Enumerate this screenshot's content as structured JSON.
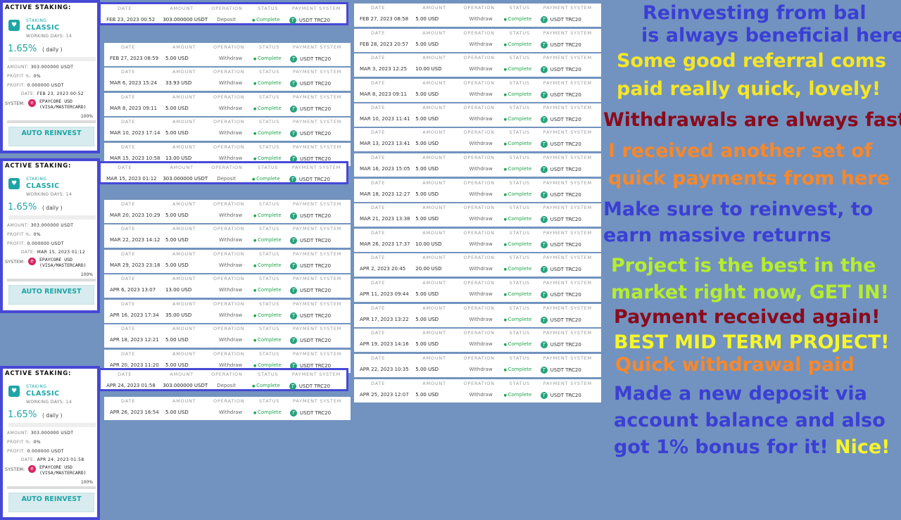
{
  "staking_cards": [
    {
      "header": "ACTIVE STAKING:",
      "sub": "STAKING",
      "name": "CLASSIC",
      "working_days": "WORKING DAYS: 14",
      "rate": "1.65%",
      "daily": "( daily )",
      "amount_label": "AMOUNT:",
      "amount": "303.000000 USDT",
      "profit_pct_label": "PROFIT %:",
      "profit_pct": "0%",
      "profit_label": "PROFIT:",
      "profit": "0.000000 USDT",
      "date_label": "DATE:",
      "date": "FEB 23, 2023 00:52",
      "system_label": "SYSTEM:",
      "system_name": "EPAYCORE USD (VISA/MASTERCARD)",
      "progress_text": "100%",
      "auto_label": "AUTO REINVEST"
    },
    {
      "header": "ACTIVE STAKING:",
      "sub": "STAKING",
      "name": "CLASSIC",
      "working_days": "WORKING DAYS: 14",
      "rate": "1.65%",
      "daily": "( daily )",
      "amount_label": "AMOUNT:",
      "amount": "303.000000 USDT",
      "profit_pct_label": "PROFIT %:",
      "profit_pct": "0%",
      "profit_label": "PROFIT:",
      "profit": "0.000000 USDT",
      "date_label": "DATE:",
      "date": "MAR 15, 2023 01:12",
      "system_label": "SYSTEM:",
      "system_name": "EPAYCORE USD (VISA/MASTERCARD)",
      "progress_text": "100%",
      "auto_label": "AUTO REINVEST"
    },
    {
      "header": "ACTIVE STAKING:",
      "sub": "STAKING",
      "name": "CLASSIC",
      "working_days": "WORKING DAYS: 14",
      "rate": "1.65%",
      "daily": "( daily )",
      "amount_label": "AMOUNT:",
      "amount": "303.000000 USDT",
      "profit_pct_label": "PROFIT %:",
      "profit_pct": "0%",
      "profit_label": "PROFIT:",
      "profit": "0.000000 USDT",
      "date_label": "DATE:",
      "date": "APR 24, 2023 01:58",
      "system_label": "SYSTEM:",
      "system_name": "EPAYCORE USD (VISA/MASTERCARD)",
      "progress_text": "100%",
      "auto_label": "AUTO REINVEST"
    }
  ],
  "headers": {
    "date": "DATE",
    "amount": "AMOUNT",
    "operation": "OPERATION",
    "status": "STATUS",
    "payment_system": "PAYMENT SYSTEM"
  },
  "transactions_left": [
    {
      "date": "FEB 23, 2023 00:52",
      "amount": "303.000000 USDT",
      "op": "Deposit",
      "status": "Complete",
      "ps": "USDT TRC20"
    },
    {
      "date": "FEB 27, 2023 08:59",
      "amount": "5.00 USD",
      "op": "Withdraw",
      "status": "Complete",
      "ps": "USDT TRC20"
    },
    {
      "date": "MAR 6, 2023 15:24",
      "amount": "33.93 USD",
      "op": "Withdraw",
      "status": "Complete",
      "ps": "USDT TRC20"
    },
    {
      "date": "MAR 8, 2023 09:11",
      "amount": "5.00 USD",
      "op": "Withdraw",
      "status": "Complete",
      "ps": "USDT TRC20"
    },
    {
      "date": "MAR 10, 2023 17:14",
      "amount": "5.00 USD",
      "op": "Withdraw",
      "status": "Complete",
      "ps": "USDT TRC20"
    },
    {
      "date": "MAR 15, 2023 10:58",
      "amount": "13.00 USD",
      "op": "Withdraw",
      "status": "Complete",
      "ps": "USDT TRC20"
    },
    {
      "date": "MAR 15, 2023 01:12",
      "amount": "303.000000 USDT",
      "op": "Deposit",
      "status": "Complete",
      "ps": "USDT TRC20"
    },
    {
      "date": "MAR 20, 2023 10:29",
      "amount": "5.00 USD",
      "op": "Withdraw",
      "status": "Complete",
      "ps": "USDT TRC20"
    },
    {
      "date": "MAR 22, 2023 14:12",
      "amount": "5.00 USD",
      "op": "Withdraw",
      "status": "Complete",
      "ps": "USDT TRC20"
    },
    {
      "date": "MAR 29, 2023 23:18",
      "amount": "5.00 USD",
      "op": "Withdraw",
      "status": "Complete",
      "ps": "USDT TRC20"
    },
    {
      "date": "APR 6, 2023 13:07",
      "amount": "13.00 USD",
      "op": "Withdraw",
      "status": "Complete",
      "ps": "USDT TRC20"
    },
    {
      "date": "APR 16, 2023 17:34",
      "amount": "35.00 USD",
      "op": "Withdraw",
      "status": "Complete",
      "ps": "USDT TRC20"
    },
    {
      "date": "APR 18, 2023 12:21",
      "amount": "5.00 USD",
      "op": "Withdraw",
      "status": "Complete",
      "ps": "USDT TRC20"
    },
    {
      "date": "APR 20, 2023 11:20",
      "amount": "5.00 USD",
      "op": "Withdraw",
      "status": "Complete",
      "ps": "USDT TRC20"
    },
    {
      "date": "APR 24, 2023 01:58",
      "amount": "303.000000 USDT",
      "op": "Deposit",
      "status": "Complete",
      "ps": "USDT TRC20"
    },
    {
      "date": "APR 26, 2023 16:54",
      "amount": "5.00 USD",
      "op": "Withdraw",
      "status": "Complete",
      "ps": "USDT TRC20"
    }
  ],
  "transactions_right": [
    {
      "date": "FEB 27, 2023 08:58",
      "amount": "5.00 USD",
      "op": "Withdraw",
      "status": "Complete",
      "ps": "USDT TRC20"
    },
    {
      "date": "FEB 28, 2023 20:57",
      "amount": "5.00 USD",
      "op": "Withdraw",
      "status": "Complete",
      "ps": "USDT TRC20"
    },
    {
      "date": "MAR 3, 2023 12:25",
      "amount": "10.00 USD",
      "op": "Withdraw",
      "status": "Complete",
      "ps": "USDT TRC20"
    },
    {
      "date": "MAR 8, 2023 09:11",
      "amount": "5.00 USD",
      "op": "Withdraw",
      "status": "Complete",
      "ps": "USDT TRC20"
    },
    {
      "date": "MAR 10, 2023 11:41",
      "amount": "5.00 USD",
      "op": "Withdraw",
      "status": "Complete",
      "ps": "USDT TRC20"
    },
    {
      "date": "MAR 13, 2023 13:41",
      "amount": "5.00 USD",
      "op": "Withdraw",
      "status": "Complete",
      "ps": "USDT TRC20"
    },
    {
      "date": "MAR 16, 2023 15:05",
      "amount": "5.00 USD",
      "op": "Withdraw",
      "status": "Complete",
      "ps": "USDT TRC20"
    },
    {
      "date": "MAR 18, 2023 12:27",
      "amount": "5.00 USD",
      "op": "Withdraw",
      "status": "Complete",
      "ps": "USDT TRC20"
    },
    {
      "date": "MAR 21, 2023 13:38",
      "amount": "5.00 USD",
      "op": "Withdraw",
      "status": "Complete",
      "ps": "USDT TRC20"
    },
    {
      "date": "MAR 26, 2023 17:37",
      "amount": "10.00 USD",
      "op": "Withdraw",
      "status": "Complete",
      "ps": "USDT TRC20"
    },
    {
      "date": "APR 2, 2023 20:45",
      "amount": "20.00 USD",
      "op": "Withdraw",
      "status": "Complete",
      "ps": "USDT TRC20"
    },
    {
      "date": "APR 11, 2023 09:44",
      "amount": "5.00 USD",
      "op": "Withdraw",
      "status": "Complete",
      "ps": "USDT TRC20"
    },
    {
      "date": "APR 17, 2023 13:22",
      "amount": "5.00 USD",
      "op": "Withdraw",
      "status": "Complete",
      "ps": "USDT TRC20"
    },
    {
      "date": "APR 19, 2023 14:16",
      "amount": "5.00 USD",
      "op": "Withdraw",
      "status": "Complete",
      "ps": "USDT TRC20"
    },
    {
      "date": "APR 22, 2023 10:35",
      "amount": "5.00 USD",
      "op": "Withdraw",
      "status": "Complete",
      "ps": "USDT TRC20"
    },
    {
      "date": "APR 25, 2023 12:07",
      "amount": "5.00 USD",
      "op": "Withdraw",
      "status": "Complete",
      "ps": "USDT TRC20"
    }
  ],
  "comments": [
    {
      "text": "Reinvesting from bal",
      "color": "#3b3fd4"
    },
    {
      "text": "is always beneficial here",
      "color": "#3b3fd4"
    },
    {
      "text": "Some good referral coms",
      "color": "#f5e626"
    },
    {
      "text": "paid really quick, lovely!",
      "color": "#f5e626"
    },
    {
      "text": "Withdrawals are always fast",
      "color": "#8a0a1c"
    },
    {
      "text": "I received another set of",
      "color": "#f5882e"
    },
    {
      "text": "quick payments from here",
      "color": "#f5882e"
    },
    {
      "text": "Make sure to reinvest, to",
      "color": "#3b3fd4"
    },
    {
      "text": "earn massive returns",
      "color": "#3b3fd4"
    },
    {
      "text": "Project is the best in the",
      "color": "#b6ee2e"
    },
    {
      "text": "market right now, GET IN!",
      "color": "#b6ee2e"
    },
    {
      "text": "Payment received again!",
      "color": "#8a0a1c"
    },
    {
      "text": "BEST MID TERM PROJECT!",
      "color": "#f5f52a"
    },
    {
      "text": "Quick withdrawal paid",
      "color": "#f5882e"
    },
    {
      "text": "Made a new deposit via",
      "color": "#3b3fd4"
    },
    {
      "text": "account balance and also",
      "color": "#3b3fd4"
    },
    {
      "text": "got 1% bonus for it!",
      "color": "#3b3fd4"
    },
    {
      "text": "Nice!",
      "color": "#f5f52a"
    }
  ],
  "colors": {
    "background": "#7293bf",
    "frame": "#4648d6",
    "accent": "#1ea5a5",
    "complete": "#23a34f",
    "tether": "#26a17b",
    "epaycore": "#d7265f"
  },
  "icons": {
    "staking_logo": "heart-logo-icon",
    "epaycore": "epaycore-icon",
    "tether": "tether-icon",
    "status_dot": "status-dot-icon"
  }
}
